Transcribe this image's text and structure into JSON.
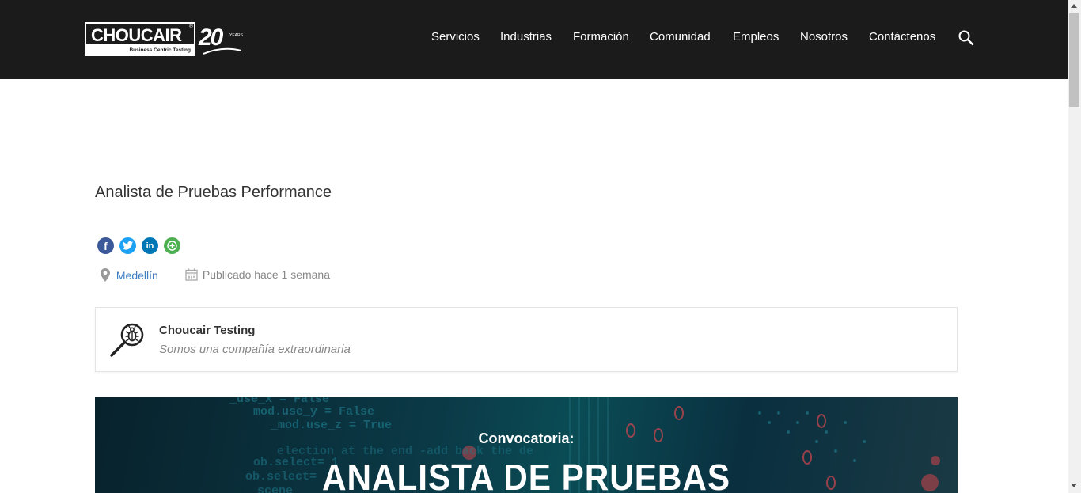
{
  "header": {
    "logo": {
      "word": "CHOUCAIR",
      "reg": "®",
      "tagline": "Business Centric Testing",
      "anniversary": "20",
      "years_text": "YEARS"
    },
    "nav": [
      {
        "label": "Servicios"
      },
      {
        "label": "Industrias"
      },
      {
        "label": "Formación"
      },
      {
        "label": "Comunidad"
      },
      {
        "label": "Empleos"
      },
      {
        "label": "Nosotros"
      },
      {
        "label": "Contáctenos"
      }
    ],
    "search_icon": "search-icon",
    "background": "#1b1b1b"
  },
  "job": {
    "title": "Analista de Pruebas Performance",
    "share": [
      {
        "icon": "facebook-icon",
        "color": "#3b5998",
        "glyph": "f"
      },
      {
        "icon": "twitter-icon",
        "color": "#1da1f2",
        "glyph": "t"
      },
      {
        "icon": "linkedin-icon",
        "color": "#0077b5",
        "glyph": "in"
      },
      {
        "icon": "more-share-icon",
        "color": "#4caf50",
        "glyph": "+"
      }
    ],
    "location": "Medellín",
    "posted": "Publicado hace 1 semana",
    "link_color": "#3d7ebf"
  },
  "company": {
    "name": "Choucair Testing",
    "tagline": "Somos una compañía extraordinaria",
    "icon": "bug-magnifier-icon"
  },
  "banner": {
    "convocatoria": "Convocatoria:",
    "headline": "ANALISTA DE PRUEBAS",
    "code_lines": [
      "_use_x = False",
      "mod.use_y = False",
      "_mod.use_z = True",
      "election at the end -add back the de",
      "ob.select= 1",
      "ob.select=",
      "scene"
    ]
  }
}
